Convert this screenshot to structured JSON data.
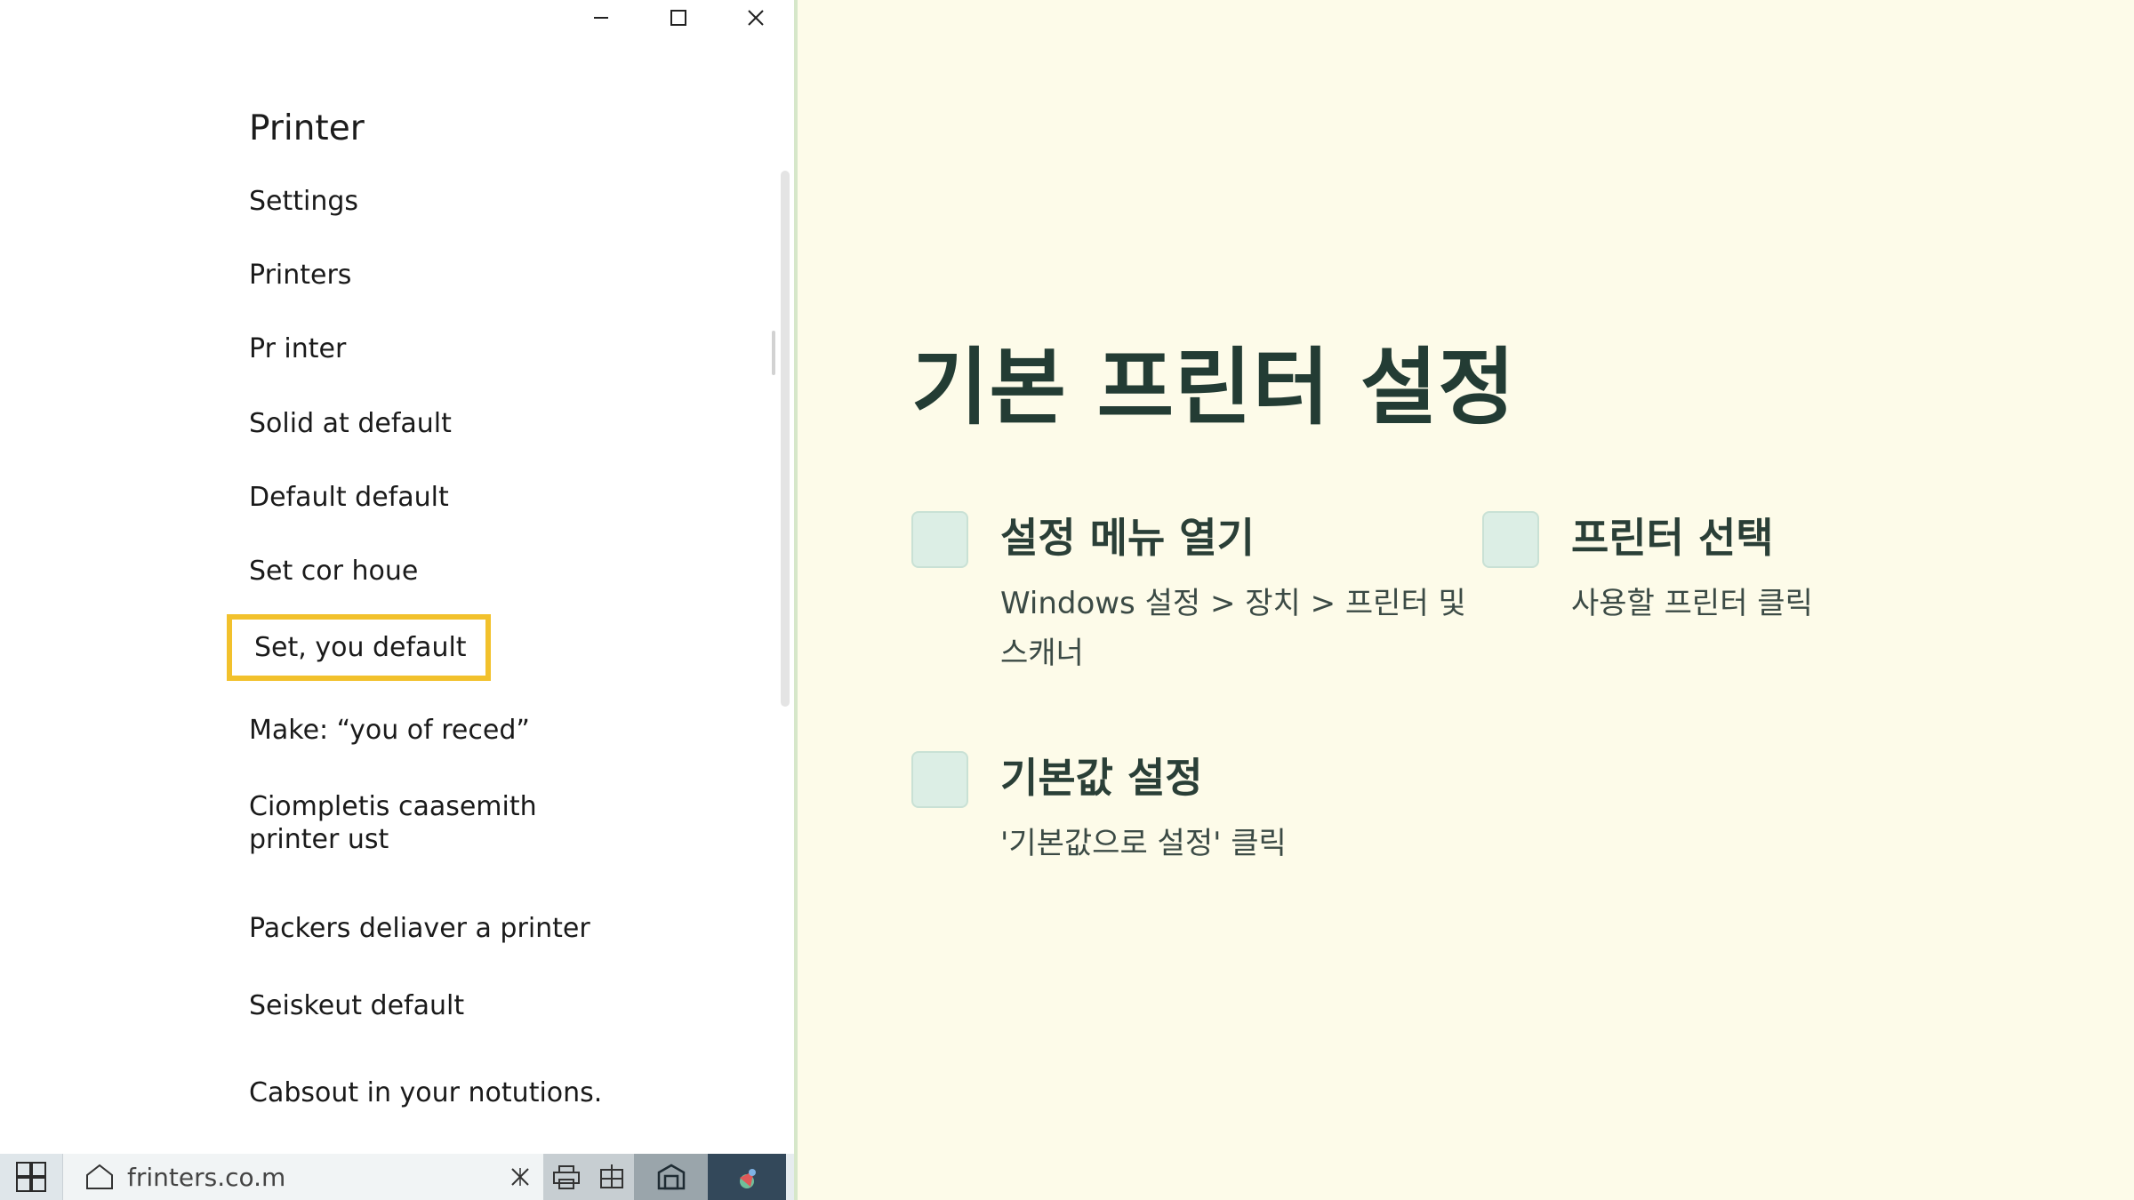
{
  "window": {
    "controls": {
      "minimize_icon": "minimize-icon",
      "maximize_icon": "maximize-icon",
      "close_icon": "close-icon"
    },
    "panel_title": "Printer",
    "menu": [
      "Settings",
      "Printers",
      "Pr inter",
      "Solid at default",
      "Default default",
      "Set cor houe",
      "Set, you default",
      "Make: “you of reced”",
      "Ciompletis caasemith printer ust",
      "Packers deliaver a printer",
      "Seiskeut default",
      "Cabsout in your notutions."
    ],
    "highlighted_item": "Set, you default",
    "highlight_color": "#f2c12c"
  },
  "taskbar": {
    "address": "frinters.co.m",
    "icons": [
      "windows-start-icon",
      "home-icon",
      "close-icon",
      "printer-icon",
      "app-icon",
      "app-icon",
      "app-icon"
    ]
  },
  "slide": {
    "title": "기본 프린터 설정",
    "steps": [
      {
        "title": "설정 메뉴 열기",
        "desc": "Windows 설정 > 장치 > 프린터 및 스캐너"
      },
      {
        "title": "프린터 선택",
        "desc": "사용할 프린터 클릭"
      },
      {
        "title": "기본값 설정",
        "desc": "'기본값으로 설정' 클릭"
      }
    ],
    "colors": {
      "background": "#fdfbe9",
      "title": "#233c34",
      "checkbox": "#dceee5"
    }
  }
}
